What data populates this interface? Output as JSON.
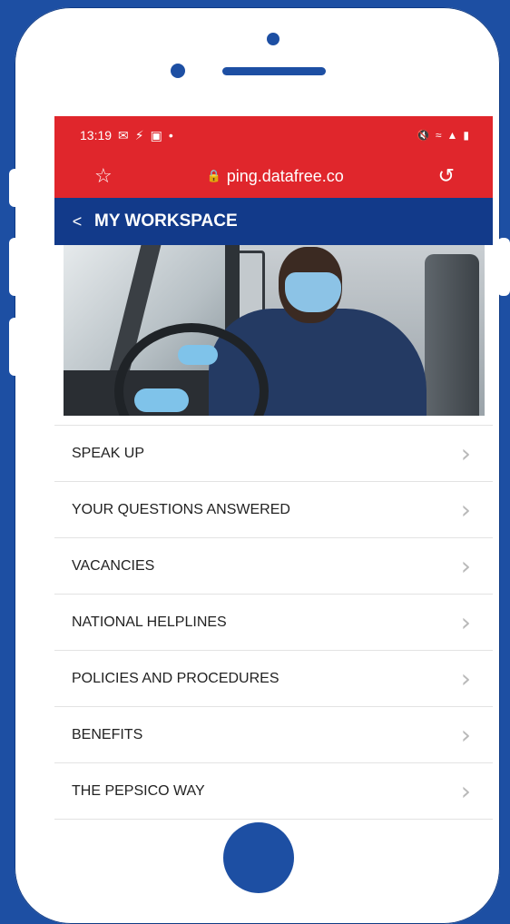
{
  "status_bar": {
    "time": "13:19",
    "notification_icons": [
      "mail-icon",
      "usb-icon",
      "image-icon",
      "dot-icon"
    ],
    "right_icons": [
      "mute-icon",
      "wifi-icon",
      "signal-icon",
      "battery-icon"
    ]
  },
  "browser": {
    "url": "ping.datafree.co",
    "icons": [
      "star-icon",
      "lock-icon",
      "reload-icon"
    ]
  },
  "header": {
    "title": "MY WORKSPACE",
    "back_icon": "back-icon"
  },
  "menu": {
    "items": [
      {
        "label": "SPEAK UP"
      },
      {
        "label": "YOUR QUESTIONS ANSWERED"
      },
      {
        "label": "VACANCIES"
      },
      {
        "label": "NATIONAL HELPLINES"
      },
      {
        "label": "POLICIES AND PROCEDURES"
      },
      {
        "label": "BENEFITS"
      },
      {
        "label": "THE PEPSICO WAY"
      }
    ]
  },
  "colors": {
    "background": "#1d4fa3",
    "browser_bar": "#e0262c",
    "header": "#123a8a"
  }
}
